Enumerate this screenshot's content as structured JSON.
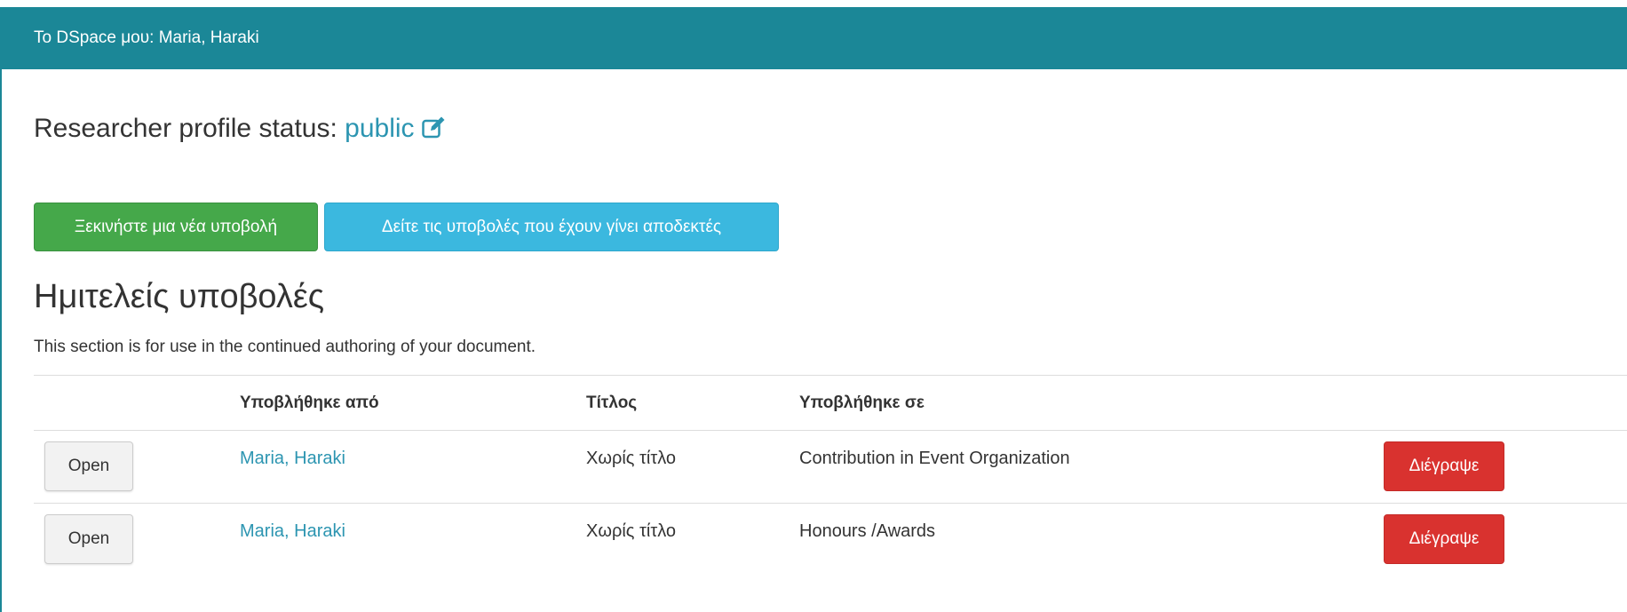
{
  "panel": {
    "title": "Το DSpace μου: Maria, Haraki"
  },
  "profile": {
    "label": "Researcher profile status:",
    "status": "public",
    "edit_icon": "edit-icon"
  },
  "actions": {
    "new_submission": "Ξεκινήστε μια νέα υποβολή",
    "view_accepted": "Δείτε τις υποβολές που έχουν γίνει αποδεκτές"
  },
  "section": {
    "title": "Ημιτελείς υποβολές",
    "description": "This section is for use in the continued authoring of your document."
  },
  "table": {
    "headers": [
      "",
      "Υποβλήθηκε από",
      "Τίτλος",
      "Υποβλήθηκε σε",
      ""
    ],
    "rows": [
      {
        "open": "Open",
        "submitted_by": "Maria, Haraki",
        "title": "Χωρίς τίτλο",
        "submitted_to": "Contribution in Event Organization",
        "delete": "Διέγραψε"
      },
      {
        "open": "Open",
        "submitted_by": "Maria, Haraki",
        "title": "Χωρίς τίτλο",
        "submitted_to": "Honours /Awards",
        "delete": "Διέγραψε"
      }
    ]
  },
  "colors": {
    "header": "#1b8797",
    "link": "#2c95b1",
    "success": "#45a84a",
    "info": "#3bb8df",
    "danger": "#d9322f"
  }
}
